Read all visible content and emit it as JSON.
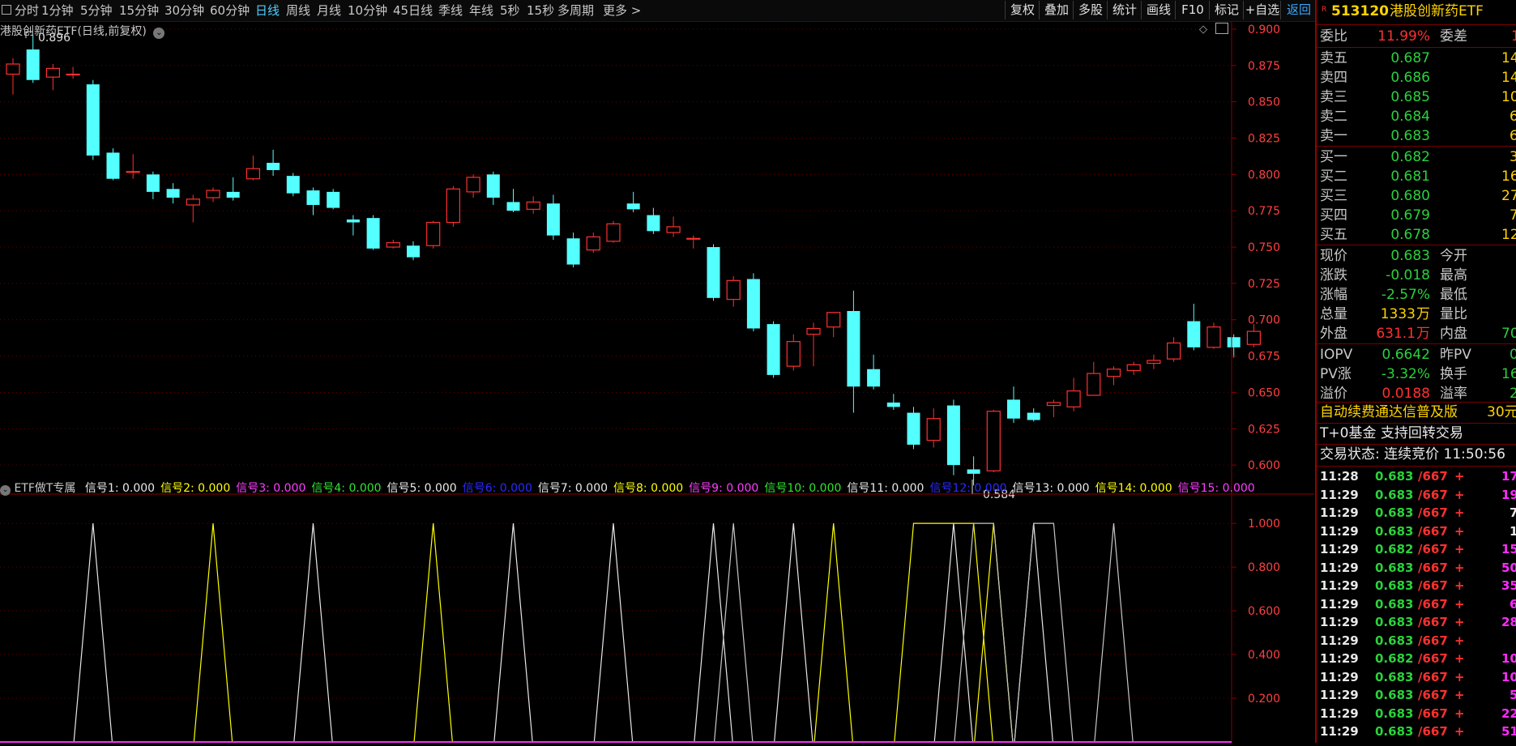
{
  "toolbar": {
    "left_tabs": [
      {
        "label": "分时",
        "active": false
      },
      {
        "label": "1分钟",
        "active": false
      },
      {
        "label": "5分钟",
        "active": false
      },
      {
        "label": "15分钟",
        "active": false
      },
      {
        "label": "30分钟",
        "active": false
      },
      {
        "label": "60分钟",
        "active": false
      },
      {
        "label": "日线",
        "active": true
      },
      {
        "label": "周线",
        "active": false
      },
      {
        "label": "月线",
        "active": false
      },
      {
        "label": "10分钟",
        "active": false
      },
      {
        "label": "45日线",
        "active": false
      },
      {
        "label": "季线",
        "active": false
      },
      {
        "label": "年线",
        "active": false
      },
      {
        "label": "5秒",
        "active": false
      },
      {
        "label": "15秒",
        "active": false
      },
      {
        "label": "多周期",
        "active": false
      },
      {
        "label": "更多 >",
        "active": false
      }
    ],
    "right_buttons": [
      "复权",
      "叠加",
      "多股",
      "统计",
      "画线",
      "F10",
      "标记",
      "+自选",
      "返回"
    ]
  },
  "main_chart": {
    "title": "港股创新药ETF(日线,前复权)",
    "high_label": "0.896",
    "low_label": "0.584",
    "y_ticks": [
      "0.900",
      "0.875",
      "0.850",
      "0.825",
      "0.800",
      "0.775",
      "0.750",
      "0.725",
      "0.700",
      "0.675",
      "0.650",
      "0.625",
      "0.600"
    ]
  },
  "indicator": {
    "title": "ETF做T专属",
    "signals": [
      {
        "label": "信号1: 0.000",
        "color": "#e8e8e8"
      },
      {
        "label": "信号2: 0.000",
        "color": "#ffff00"
      },
      {
        "label": "信号3: 0.000",
        "color": "#ff3cff"
      },
      {
        "label": "信号4: 0.000",
        "color": "#2fe52f"
      },
      {
        "label": "信号5: 0.000",
        "color": "#e8e8e8"
      },
      {
        "label": "信号6: 0.000",
        "color": "#2a2aff"
      },
      {
        "label": "信号7: 0.000",
        "color": "#e8e8e8"
      },
      {
        "label": "信号8: 0.000",
        "color": "#ffff00"
      },
      {
        "label": "信号9: 0.000",
        "color": "#ff3cff"
      },
      {
        "label": "信号10: 0.000",
        "color": "#2fe52f"
      },
      {
        "label": "信号11: 0.000",
        "color": "#e8e8e8"
      },
      {
        "label": "信号12: 0.000",
        "color": "#2a2aff"
      },
      {
        "label": "信号13: 0.000",
        "color": "#e8e8e8"
      },
      {
        "label": "信号14: 0.000",
        "color": "#ffff00"
      },
      {
        "label": "信号15: 0.000",
        "color": "#ff3cff"
      }
    ],
    "y_ticks": [
      "1.000",
      "0.800",
      "0.600",
      "0.400",
      "0.200"
    ]
  },
  "chart_data": {
    "type": "candlestick",
    "ylim": [
      0.58,
      0.905
    ],
    "candles": [
      {
        "o": 0.869,
        "h": 0.88,
        "l": 0.855,
        "c": 0.876
      },
      {
        "o": 0.886,
        "h": 0.896,
        "l": 0.863,
        "c": 0.865
      },
      {
        "o": 0.867,
        "h": 0.876,
        "l": 0.858,
        "c": 0.873
      },
      {
        "o": 0.869,
        "h": 0.874,
        "l": 0.866,
        "c": 0.869
      },
      {
        "o": 0.862,
        "h": 0.865,
        "l": 0.81,
        "c": 0.813
      },
      {
        "o": 0.815,
        "h": 0.818,
        "l": 0.796,
        "c": 0.797
      },
      {
        "o": 0.802,
        "h": 0.814,
        "l": 0.797,
        "c": 0.802
      },
      {
        "o": 0.8,
        "h": 0.802,
        "l": 0.783,
        "c": 0.788
      },
      {
        "o": 0.79,
        "h": 0.794,
        "l": 0.78,
        "c": 0.784
      },
      {
        "o": 0.779,
        "h": 0.786,
        "l": 0.767,
        "c": 0.783
      },
      {
        "o": 0.784,
        "h": 0.791,
        "l": 0.781,
        "c": 0.789
      },
      {
        "o": 0.788,
        "h": 0.798,
        "l": 0.782,
        "c": 0.784
      },
      {
        "o": 0.797,
        "h": 0.813,
        "l": 0.796,
        "c": 0.804
      },
      {
        "o": 0.808,
        "h": 0.817,
        "l": 0.799,
        "c": 0.803
      },
      {
        "o": 0.799,
        "h": 0.801,
        "l": 0.785,
        "c": 0.787
      },
      {
        "o": 0.789,
        "h": 0.791,
        "l": 0.772,
        "c": 0.779
      },
      {
        "o": 0.788,
        "h": 0.79,
        "l": 0.776,
        "c": 0.777
      },
      {
        "o": 0.769,
        "h": 0.772,
        "l": 0.758,
        "c": 0.767
      },
      {
        "o": 0.77,
        "h": 0.772,
        "l": 0.748,
        "c": 0.749
      },
      {
        "o": 0.75,
        "h": 0.755,
        "l": 0.749,
        "c": 0.753
      },
      {
        "o": 0.751,
        "h": 0.754,
        "l": 0.741,
        "c": 0.743
      },
      {
        "o": 0.751,
        "h": 0.768,
        "l": 0.749,
        "c": 0.767
      },
      {
        "o": 0.767,
        "h": 0.792,
        "l": 0.764,
        "c": 0.79
      },
      {
        "o": 0.788,
        "h": 0.8,
        "l": 0.784,
        "c": 0.798
      },
      {
        "o": 0.8,
        "h": 0.802,
        "l": 0.779,
        "c": 0.784
      },
      {
        "o": 0.781,
        "h": 0.79,
        "l": 0.774,
        "c": 0.775
      },
      {
        "o": 0.776,
        "h": 0.785,
        "l": 0.773,
        "c": 0.781
      },
      {
        "o": 0.78,
        "h": 0.786,
        "l": 0.755,
        "c": 0.758
      },
      {
        "o": 0.756,
        "h": 0.76,
        "l": 0.736,
        "c": 0.738
      },
      {
        "o": 0.748,
        "h": 0.76,
        "l": 0.746,
        "c": 0.757
      },
      {
        "o": 0.754,
        "h": 0.768,
        "l": 0.753,
        "c": 0.766
      },
      {
        "o": 0.78,
        "h": 0.788,
        "l": 0.774,
        "c": 0.776
      },
      {
        "o": 0.772,
        "h": 0.777,
        "l": 0.759,
        "c": 0.761
      },
      {
        "o": 0.76,
        "h": 0.771,
        "l": 0.757,
        "c": 0.764
      },
      {
        "o": 0.756,
        "h": 0.758,
        "l": 0.749,
        "c": 0.756
      },
      {
        "o": 0.75,
        "h": 0.752,
        "l": 0.713,
        "c": 0.715
      },
      {
        "o": 0.714,
        "h": 0.73,
        "l": 0.709,
        "c": 0.727
      },
      {
        "o": 0.728,
        "h": 0.732,
        "l": 0.692,
        "c": 0.694
      },
      {
        "o": 0.697,
        "h": 0.699,
        "l": 0.66,
        "c": 0.662
      },
      {
        "o": 0.668,
        "h": 0.69,
        "l": 0.665,
        "c": 0.685
      },
      {
        "o": 0.69,
        "h": 0.698,
        "l": 0.668,
        "c": 0.694
      },
      {
        "o": 0.695,
        "h": 0.705,
        "l": 0.688,
        "c": 0.705
      },
      {
        "o": 0.706,
        "h": 0.72,
        "l": 0.636,
        "c": 0.654
      },
      {
        "o": 0.666,
        "h": 0.676,
        "l": 0.652,
        "c": 0.654
      },
      {
        "o": 0.643,
        "h": 0.649,
        "l": 0.638,
        "c": 0.64
      },
      {
        "o": 0.636,
        "h": 0.64,
        "l": 0.611,
        "c": 0.614
      },
      {
        "o": 0.617,
        "h": 0.639,
        "l": 0.612,
        "c": 0.632
      },
      {
        "o": 0.641,
        "h": 0.645,
        "l": 0.593,
        "c": 0.6
      },
      {
        "o": 0.597,
        "h": 0.606,
        "l": 0.586,
        "c": 0.594
      },
      {
        "o": 0.596,
        "h": 0.638,
        "l": 0.595,
        "c": 0.637
      },
      {
        "o": 0.645,
        "h": 0.654,
        "l": 0.629,
        "c": 0.632
      },
      {
        "o": 0.636,
        "h": 0.639,
        "l": 0.63,
        "c": 0.631
      },
      {
        "o": 0.641,
        "h": 0.645,
        "l": 0.633,
        "c": 0.643
      },
      {
        "o": 0.64,
        "h": 0.66,
        "l": 0.637,
        "c": 0.651
      },
      {
        "o": 0.648,
        "h": 0.671,
        "l": 0.648,
        "c": 0.663
      },
      {
        "o": 0.661,
        "h": 0.668,
        "l": 0.655,
        "c": 0.666
      },
      {
        "o": 0.665,
        "h": 0.671,
        "l": 0.662,
        "c": 0.669
      },
      {
        "o": 0.67,
        "h": 0.676,
        "l": 0.666,
        "c": 0.672
      },
      {
        "o": 0.673,
        "h": 0.688,
        "l": 0.671,
        "c": 0.684
      },
      {
        "o": 0.699,
        "h": 0.711,
        "l": 0.679,
        "c": 0.681
      },
      {
        "o": 0.681,
        "h": 0.698,
        "l": 0.68,
        "c": 0.695
      },
      {
        "o": 0.688,
        "h": 0.69,
        "l": 0.674,
        "c": 0.681
      },
      {
        "o": 0.683,
        "h": 0.697,
        "l": 0.681,
        "c": 0.692
      }
    ],
    "signals": [
      {
        "color": "#e8e8e8",
        "peaks": [
          [
            4
          ],
          [
            15
          ],
          [
            25
          ],
          [
            30
          ],
          [
            35
          ],
          [
            39
          ],
          [
            47
          ],
          [
            51
          ]
        ]
      },
      {
        "color": "#ffff00",
        "peaks": [
          [
            10
          ],
          [
            21
          ],
          [
            41
          ],
          [
            45,
            46,
            47,
            48
          ],
          [
            49
          ]
        ]
      },
      {
        "color": "#c8c8c8",
        "peaks": [
          [
            36
          ],
          [
            48,
            49
          ],
          [
            51,
            52
          ],
          [
            55
          ]
        ]
      }
    ]
  },
  "quote_panel": {
    "code": "513120",
    "name": "港股创新药ETF",
    "ratio_label": "委比",
    "ratio_value": "11.99%",
    "diff_label": "委差",
    "diff_value": "1",
    "asks": [
      {
        "label": "卖五",
        "price": "0.687",
        "vol": "14"
      },
      {
        "label": "卖四",
        "price": "0.686",
        "vol": "14"
      },
      {
        "label": "卖三",
        "price": "0.685",
        "vol": "10"
      },
      {
        "label": "卖二",
        "price": "0.684",
        "vol": "6"
      },
      {
        "label": "卖一",
        "price": "0.683",
        "vol": "6"
      }
    ],
    "bids": [
      {
        "label": "买一",
        "price": "0.682",
        "vol": "3"
      },
      {
        "label": "买二",
        "price": "0.681",
        "vol": "16"
      },
      {
        "label": "买三",
        "price": "0.680",
        "vol": "27"
      },
      {
        "label": "买四",
        "price": "0.679",
        "vol": "7"
      },
      {
        "label": "买五",
        "price": "0.678",
        "vol": "12"
      }
    ],
    "stats": [
      {
        "label": "现价",
        "value": "0.683",
        "color": "green",
        "label2": "今开",
        "value2": ""
      },
      {
        "label": "涨跌",
        "value": "-0.018",
        "color": "green",
        "label2": "最高",
        "value2": ""
      },
      {
        "label": "涨幅",
        "value": "-2.57%",
        "color": "green",
        "label2": "最低",
        "value2": ""
      },
      {
        "label": "总量",
        "value": "1333",
        "unit": "万",
        "color": "yellow",
        "label2": "量比",
        "value2": ""
      },
      {
        "label": "外盘",
        "value": "631.1",
        "unit": "万",
        "color": "red",
        "label2": "内盘",
        "value2": "70"
      }
    ],
    "stats2": [
      {
        "label": "IOPV",
        "value": "0.6642",
        "color": "green",
        "label2": "昨PV",
        "value2": "0"
      },
      {
        "label": "PV涨",
        "value": "-3.32%",
        "color": "green",
        "label2": "换手",
        "value2": "16"
      },
      {
        "label": "溢价",
        "value": "0.0188",
        "color": "red",
        "label2": "溢率",
        "value2": "2"
      }
    ],
    "promo": {
      "text": "自动续费通达信普及版",
      "price": "30元"
    },
    "t0_text": "T+0基金 支持回转交易",
    "status_text": "交易状态: 连续竞价 11:50:56",
    "ticks": [
      {
        "time": "11:28",
        "price": "0.683",
        "ask": "/667",
        "sign": "+",
        "vol": "17",
        "pcolor": "green",
        "vcolor": "magenta"
      },
      {
        "time": "11:29",
        "price": "0.683",
        "ask": "/667",
        "sign": "+",
        "vol": "19",
        "pcolor": "green",
        "vcolor": "magenta"
      },
      {
        "time": "11:29",
        "price": "0.683",
        "ask": "/667",
        "sign": "+",
        "vol": "7",
        "pcolor": "green",
        "vcolor": "white"
      },
      {
        "time": "11:29",
        "price": "0.683",
        "ask": "/667",
        "sign": "+",
        "vol": "1",
        "pcolor": "green",
        "vcolor": "white"
      },
      {
        "time": "11:29",
        "price": "0.682",
        "ask": "/667",
        "sign": "+",
        "vol": "15",
        "pcolor": "green",
        "vcolor": "magenta"
      },
      {
        "time": "11:29",
        "price": "0.683",
        "ask": "/667",
        "sign": "+",
        "vol": "50",
        "pcolor": "green",
        "vcolor": "magenta"
      },
      {
        "time": "11:29",
        "price": "0.683",
        "ask": "/667",
        "sign": "+",
        "vol": "35",
        "pcolor": "green",
        "vcolor": "magenta"
      },
      {
        "time": "11:29",
        "price": "0.683",
        "ask": "/667",
        "sign": "+",
        "vol": "6",
        "pcolor": "green",
        "vcolor": "magenta"
      },
      {
        "time": "11:29",
        "price": "0.683",
        "ask": "/667",
        "sign": "+",
        "vol": "28",
        "pcolor": "green",
        "vcolor": "magenta"
      },
      {
        "time": "11:29",
        "price": "0.683",
        "ask": "/667",
        "sign": "+",
        "vol": "",
        "pcolor": "green",
        "vcolor": "white"
      },
      {
        "time": "11:29",
        "price": "0.682",
        "ask": "/667",
        "sign": "+",
        "vol": "10",
        "pcolor": "green",
        "vcolor": "magenta"
      },
      {
        "time": "11:29",
        "price": "0.683",
        "ask": "/667",
        "sign": "+",
        "vol": "10",
        "pcolor": "green",
        "vcolor": "magenta"
      },
      {
        "time": "11:29",
        "price": "0.683",
        "ask": "/667",
        "sign": "+",
        "vol": "5",
        "pcolor": "green",
        "vcolor": "magenta"
      },
      {
        "time": "11:29",
        "price": "0.683",
        "ask": "/667",
        "sign": "+",
        "vol": "22",
        "pcolor": "green",
        "vcolor": "magenta"
      },
      {
        "time": "11:29",
        "price": "0.683",
        "ask": "/667",
        "sign": "+",
        "vol": "51",
        "pcolor": "green",
        "vcolor": "magenta"
      }
    ]
  }
}
